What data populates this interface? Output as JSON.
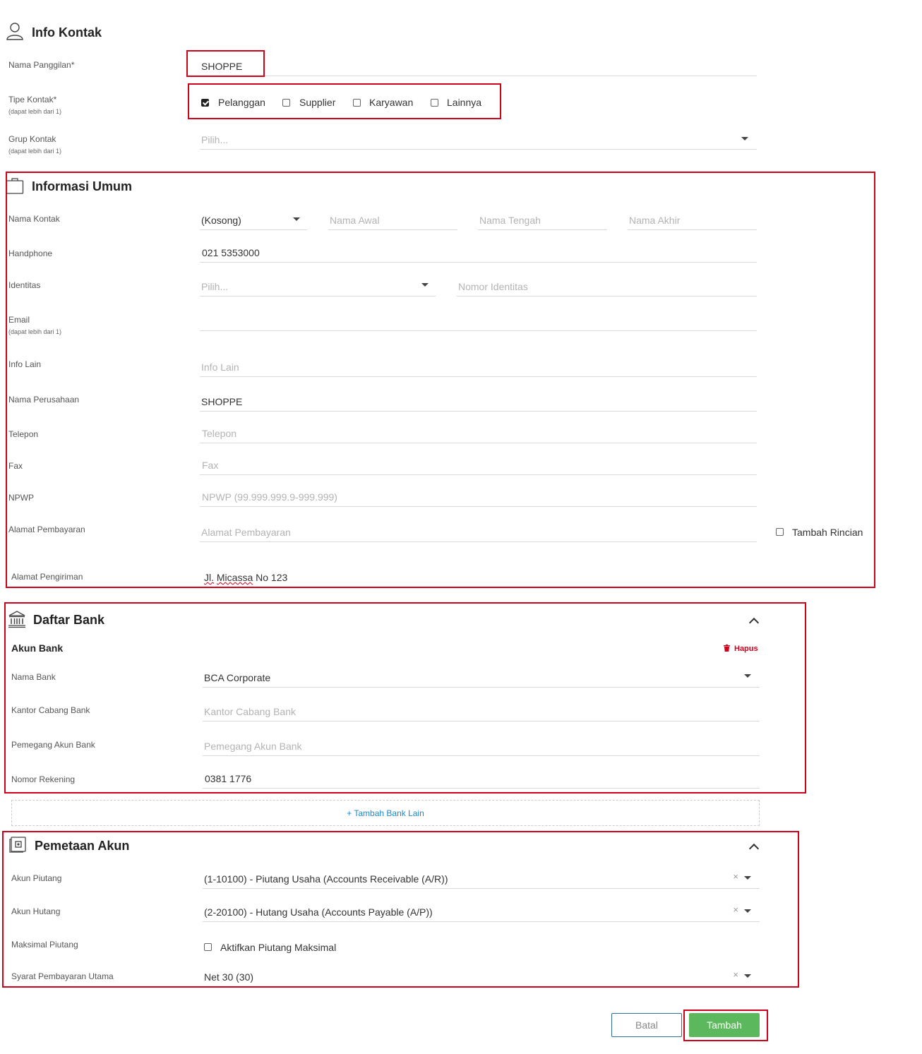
{
  "info_kontak": {
    "title": "Info Kontak",
    "nama_panggilan_label": "Nama Panggilan*",
    "nama_panggilan_value": "SHOPPE",
    "tipe_kontak_label": "Tipe Kontak*",
    "tipe_kontak_sub": "(dapat lebih dari 1)",
    "tipe_options": [
      {
        "label": "Pelanggan",
        "checked": true
      },
      {
        "label": "Supplier",
        "checked": false
      },
      {
        "label": "Karyawan",
        "checked": false
      },
      {
        "label": "Lainnya",
        "checked": false
      }
    ],
    "grup_kontak_label": "Grup Kontak",
    "grup_kontak_sub": "(dapat lebih dari 1)",
    "grup_kontak_placeholder": "Pilih..."
  },
  "informasi_umum": {
    "title": "Informasi Umum",
    "nama_kontak_label": "Nama Kontak",
    "salutation_value": "(Kosong)",
    "nama_awal_placeholder": "Nama Awal",
    "nama_tengah_placeholder": "Nama Tengah",
    "nama_akhir_placeholder": "Nama Akhir",
    "handphone_label": "Handphone",
    "handphone_value": "021 5353000",
    "identitas_label": "Identitas",
    "identitas_placeholder": "Pilih...",
    "nomor_identitas_placeholder": "Nomor Identitas",
    "email_label": "Email",
    "email_sub": "(dapat lebih dari 1)",
    "info_lain_label": "Info Lain",
    "info_lain_placeholder": "Info Lain",
    "nama_perusahaan_label": "Nama Perusahaan",
    "nama_perusahaan_value": "SHOPPE",
    "telepon_label": "Telepon",
    "telepon_placeholder": "Telepon",
    "fax_label": "Fax",
    "fax_placeholder": "Fax",
    "npwp_label": "NPWP",
    "npwp_placeholder": "NPWP (99.999.999.9-999.999)",
    "alamat_pembayaran_label": "Alamat Pembayaran",
    "alamat_pembayaran_placeholder": "Alamat Pembayaran",
    "tambah_rincian_label": "Tambah Rincian",
    "alamat_pengiriman_label": "Alamat Pengiriman",
    "alamat_pengiriman_part1": "Jl.",
    "alamat_pengiriman_part2": "Micassa",
    "alamat_pengiriman_part3": "No 123"
  },
  "daftar_bank": {
    "title": "Daftar Bank",
    "akun_bank_title": "Akun Bank",
    "hapus_label": "Hapus",
    "nama_bank_label": "Nama Bank",
    "nama_bank_value": "BCA Corporate",
    "kantor_cabang_label": "Kantor Cabang Bank",
    "kantor_cabang_placeholder": "Kantor Cabang Bank",
    "pemegang_label": "Pemegang Akun Bank",
    "pemegang_placeholder": "Pemegang Akun Bank",
    "nomor_rekening_label": "Nomor Rekening",
    "nomor_rekening_value": "0381 1776",
    "tambah_bank_label": "+ Tambah Bank Lain"
  },
  "pemetaan_akun": {
    "title": "Pemetaan Akun",
    "akun_piutang_label": "Akun Piutang",
    "akun_piutang_value": "(1-10100) - Piutang Usaha (Accounts Receivable (A/R))",
    "akun_hutang_label": "Akun Hutang",
    "akun_hutang_value": "(2-20100) - Hutang Usaha (Accounts Payable (A/P))",
    "maksimal_piutang_label": "Maksimal Piutang",
    "aktifkan_label": "Aktifkan Piutang Maksimal",
    "syarat_label": "Syarat Pembayaran Utama",
    "syarat_value": "Net 30 (30)",
    "clear_symbol": "×"
  },
  "actions": {
    "batal_label": "Batal",
    "tambah_label": "Tambah"
  },
  "colors": {
    "highlight": "#d0021b",
    "primary_green": "#5cb85c",
    "link_blue": "#1e88c8"
  }
}
